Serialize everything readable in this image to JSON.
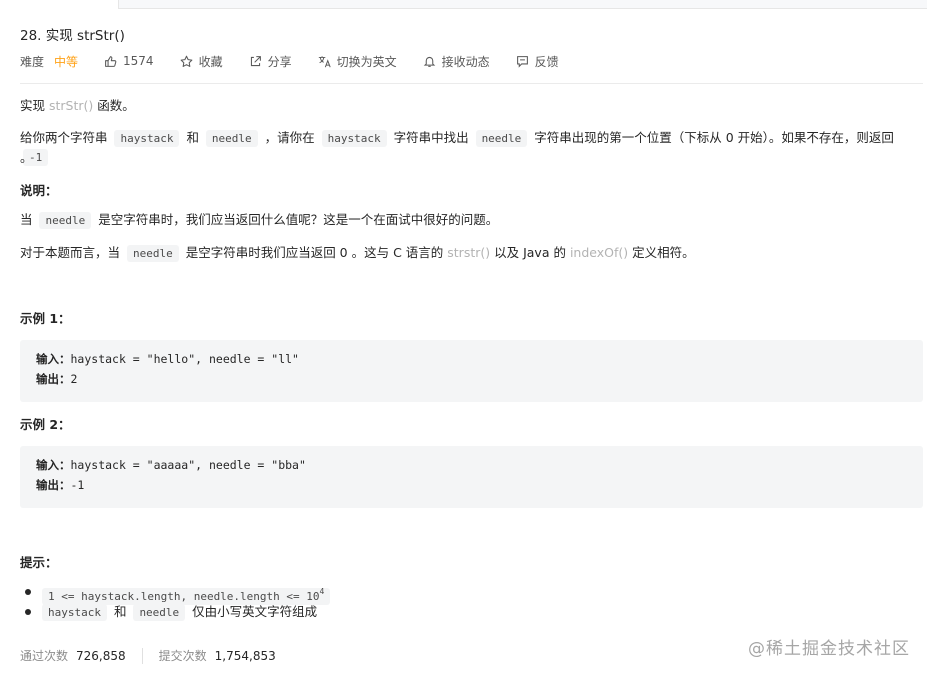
{
  "problem": {
    "title": "28. 实现 strStr()",
    "difficulty_label": "难度",
    "difficulty": "中等",
    "likes": "1574",
    "favorite": "收藏",
    "share": "分享",
    "switch_lang": "切换为英文",
    "notify": "接收动态",
    "feedback": "反馈"
  },
  "desc": {
    "line1_a": "实现 ",
    "line1_link": "strStr()",
    "line1_b": " 函数。",
    "line2_a": "给你两个字符串 ",
    "line2_code1": "haystack",
    "line2_b": " 和 ",
    "line2_code2": "needle",
    "line2_c": " ，请你在 ",
    "line2_code3": "haystack",
    "line2_d": " 字符串中找出 ",
    "line2_code4": "needle",
    "line2_e": " 字符串出现的第一个位置（下标从 0 开始）。如果不存在，则返回 ",
    "line2_code5": "-1",
    "line2_end": "。",
    "explain_heading": "说明：",
    "explain1_a": "当 ",
    "explain1_code": "needle",
    "explain1_b": " 是空字符串时，我们应当返回什么值呢？这是一个在面试中很好的问题。",
    "explain2_a": "对于本题而言，当 ",
    "explain2_code": "needle",
    "explain2_b": " 是空字符串时我们应当返回 0 。这与 C 语言的 ",
    "explain2_link1": "strstr()",
    "explain2_c": " 以及 Java 的 ",
    "explain2_link2": "indexOf()",
    "explain2_d": " 定义相符。"
  },
  "examples": [
    {
      "heading": "示例 1：",
      "input_label": "输入：",
      "input": "haystack = \"hello\", needle = \"ll\"",
      "output_label": "输出：",
      "output": "2"
    },
    {
      "heading": "示例 2：",
      "input_label": "输入：",
      "input": "haystack = \"aaaaa\", needle = \"bba\"",
      "output_label": "输出：",
      "output": "-1"
    }
  ],
  "tips": {
    "heading": "提示：",
    "tip1_code": "1 <= haystack.length, needle.length <= 10",
    "tip1_sup": "4",
    "tip2_code1": "haystack",
    "tip2_a": " 和 ",
    "tip2_code2": "needle",
    "tip2_b": " 仅由小写英文字符组成"
  },
  "stats": {
    "accepted_label": "通过次数",
    "accepted": "726,858",
    "submitted_label": "提交次数",
    "submitted": "1,754,853"
  },
  "watermark": "@稀土掘金技术社区",
  "colors": {
    "accent": "#ffa116",
    "text": "#262626",
    "muted": "#8c8c8c",
    "code_bg": "#f3f4f5"
  },
  "icons": [
    "thumbs-up-icon",
    "star-icon",
    "share-icon",
    "translate-icon",
    "bell-icon",
    "feedback-icon"
  ]
}
